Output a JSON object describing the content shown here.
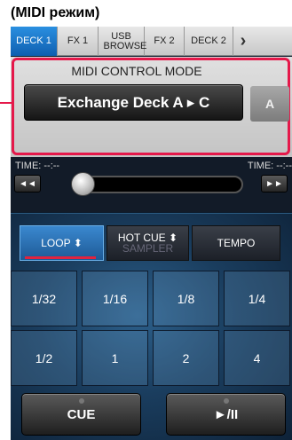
{
  "caption": "(MIDI режим)",
  "tabs": [
    {
      "label": "DECK 1",
      "active": true
    },
    {
      "label": "FX 1",
      "active": false
    },
    {
      "label": "USB BROWSE",
      "active": false
    },
    {
      "label": "FX 2",
      "active": false
    },
    {
      "label": "DECK 2",
      "active": false
    }
  ],
  "next_icon": "chevron-right-icon",
  "midi": {
    "title": "MIDI CONTROL MODE",
    "exchange_label": "Exchange Deck A ▸ C",
    "deck_letter": "A"
  },
  "time": {
    "left": "TIME: --:--",
    "right": "TIME: --:--"
  },
  "seek": {
    "position": 0.05,
    "prev_icon": "skip-back-icon",
    "next_icon": "skip-forward-icon"
  },
  "modes": {
    "loop": "LOOP ⬍",
    "hotcue": "HOT CUE ⬍",
    "sampler": "SAMPLER",
    "tempo": "TEMPO",
    "active": "loop"
  },
  "pads": [
    [
      "1/32",
      "1/16",
      "1/8",
      "1/4"
    ],
    [
      "1/2",
      "1",
      "2",
      "4"
    ]
  ],
  "buttons": {
    "cue": "CUE",
    "play": "►/II"
  },
  "colors": {
    "accent_blue": "#1a75c8",
    "highlight_red": "#e5184a"
  }
}
